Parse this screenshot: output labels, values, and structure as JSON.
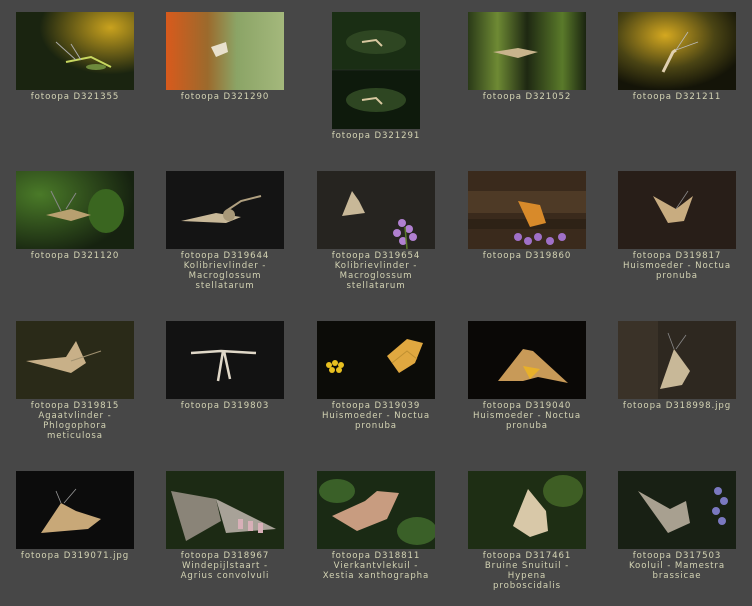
{
  "gallery": {
    "items": [
      {
        "caption": "fotoopa D321355"
      },
      {
        "caption": "fotoopa D321290"
      },
      {
        "caption": "fotoopa D321291"
      },
      {
        "caption": "fotoopa D321052"
      },
      {
        "caption": "fotoopa D321211"
      },
      {
        "caption": "fotoopa D321120"
      },
      {
        "caption": "fotoopa D319644\nKolibrievlinder -\nMacroglossum\nstellatarum"
      },
      {
        "caption": "fotoopa D319654\nKolibrievlinder -\nMacroglossum\nstellatarum"
      },
      {
        "caption": "fotoopa D319860"
      },
      {
        "caption": "fotoopa D319817\nHuismoeder - Noctua\npronuba"
      },
      {
        "caption": "fotoopa D319815\nAgaatvlinder -\nPhlogophora\nmeticulosa"
      },
      {
        "caption": "fotoopa D319803"
      },
      {
        "caption": "fotoopa D319039\nHuismoeder - Noctua\npronuba"
      },
      {
        "caption": "fotoopa D319040\nHuismoeder - Noctua\npronuba"
      },
      {
        "caption": "fotoopa D318998.jpg"
      },
      {
        "caption": "fotoopa D319071.jpg"
      },
      {
        "caption": "fotoopa D318967\nWindepijlstaart -\nAgrius convolvuli"
      },
      {
        "caption": "fotoopa D318811\nVierkantvlekuil -\nXestia xanthographa"
      },
      {
        "caption": "fotoopa D317461\nBruine Snuituil -\nHypena\nproboscidalis"
      },
      {
        "caption": "fotoopa D317503\nKooluil - Mamestra\nbrassicae"
      }
    ]
  }
}
